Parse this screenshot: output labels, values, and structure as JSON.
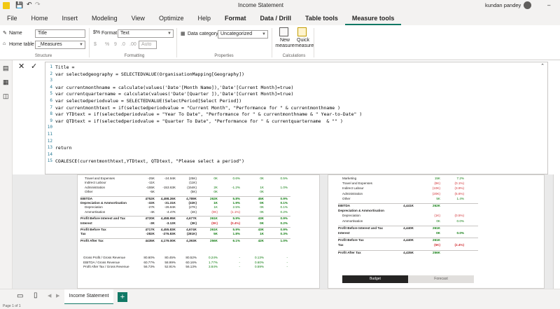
{
  "window": {
    "title": "Income Statement",
    "user": "kundan pandey"
  },
  "tabs": [
    {
      "label": "File"
    },
    {
      "label": "Home"
    },
    {
      "label": "Insert"
    },
    {
      "label": "Modeling"
    },
    {
      "label": "View"
    },
    {
      "label": "Optimize"
    },
    {
      "label": "Help"
    },
    {
      "label": "Format"
    },
    {
      "label": "Data / Drill"
    },
    {
      "label": "Table tools"
    },
    {
      "label": "Measure tools"
    }
  ],
  "ribbon": {
    "structure": {
      "name_label": "Name",
      "name_value": "Title",
      "hometable_label": "Home table",
      "hometable_value": "_Measures",
      "group": "Structure"
    },
    "formatting": {
      "format_label": "Format",
      "format_value": "Text",
      "auto_value": "Auto",
      "currency": "$",
      "percent": "%",
      "comma": "9",
      "group": "Formatting"
    },
    "properties": {
      "category_label": "Data category",
      "category_value": "Uncategorized",
      "group": "Properties"
    },
    "calculations": {
      "new_measure": "New measure",
      "quick_measure": "Quick measure",
      "group": "Calculations"
    }
  },
  "code_lines": [
    {
      "n": "1",
      "t": "Title ="
    },
    {
      "n": "2",
      "t": "var selectedgeography = SELECTEDVALUE(OrganisationMapping[Geography])"
    },
    {
      "n": "3",
      "t": ""
    },
    {
      "n": "4",
      "t": "var currentmonthname = calculate(values('Date'[Month Name]),'Date'[Current Month]=true)"
    },
    {
      "n": "5",
      "t": "var currentquartername = calculate(values('Date'[Quarter ]),'Date'[Current Month]=true)"
    },
    {
      "n": "6",
      "t": "var selectedperiodvalue = SELECTEDVALUE(SelectPeriod[Select Period])"
    },
    {
      "n": "7",
      "t": "var currentmonthtext = if(selectedperiodvalue = \"Current Month\", \"Performance for \" & currentmonthname )"
    },
    {
      "n": "8",
      "t": "var YTDtext = if(selectedperiodvalue = \"Year To Date\", \"Performance for \" & currentmonthname & \" Year-to-Date\" )"
    },
    {
      "n": "9",
      "t": "var QTDtext = if(selectedperiodvalue = \"Quarter To Date\", \"Performance for \" & currentquartername  & \"\" )"
    },
    {
      "n": "10",
      "t": ""
    },
    {
      "n": "11",
      "t": ""
    },
    {
      "n": "12",
      "t": ""
    },
    {
      "n": "13",
      "t": "return"
    },
    {
      "n": "14",
      "t": ""
    },
    {
      "n": "15",
      "t": "COALESCE(currentmonthtext,YTDtext, QTDtext, \"Please select a period\")"
    }
  ],
  "left_report": {
    "rows": [
      {
        "label": "Travel and Expenses",
        "a": "-25K",
        "b": "-24.94K",
        "c": "(25K)",
        "d": "0K",
        "e": "0.6%",
        "f": "0K",
        "g": "0.5%",
        "bold": false
      },
      {
        "label": "Indirect Labour",
        "a": "-11K",
        "b": "",
        "c": "(11K)",
        "d": "",
        "e": "",
        "f": "",
        "g": "",
        "bold": false
      },
      {
        "label": "Administration",
        "a": "-155K",
        "b": "-153.63K",
        "c": "(154K)",
        "d": "2K",
        "e": "-1.2%",
        "f": "1K",
        "g": "1.0%",
        "bold": false
      },
      {
        "label": "Other",
        "a": "-5K",
        "b": "",
        "c": "(5K)",
        "d": "0K",
        "e": "",
        "f": "0K",
        "g": "",
        "bold": false
      },
      {
        "label": "EBITDA",
        "a": "4752K",
        "b": "4,498.26K",
        "c": "4,789K",
        "d": "262K",
        "e": "5.8%",
        "f": "45K",
        "g": "0.9%",
        "bold": true
      },
      {
        "label": "Depreciation & Ammortisation",
        "a": "-32K",
        "b": "-31.31K",
        "c": "(32K)",
        "d": "1K",
        "e": "1.9%",
        "f": "0K",
        "g": "0.1%",
        "bold": true
      },
      {
        "label": "Depreciation",
        "a": "-27K",
        "b": "-26.84K",
        "c": "(27K)",
        "d": "1K",
        "e": "2.5%",
        "f": "0K",
        "g": "0.1%",
        "bold": false
      },
      {
        "label": "Ammortisation",
        "a": "-4K",
        "b": "-4.47K",
        "c": "(4K)",
        "d": "(0K)",
        "e": "(1.1%)",
        "f": "0K",
        "g": "0.2%",
        "bold": false
      },
      {
        "label": "Profit Before Interest and Tax",
        "a": "4720K",
        "b": "4,458.95K",
        "c": "4,677K",
        "d": "261K",
        "e": "5.9%",
        "f": "43K",
        "g": "0.9%",
        "bold": true
      },
      {
        "label": "Interest",
        "a": "-3K",
        "b": "-3.12K",
        "c": "(3K)",
        "d": "(0K)",
        "e": "(0.4%)",
        "f": "0K",
        "g": "0.2%",
        "bold": true
      },
      {
        "label": "Profit Before Tax",
        "a": "4717K",
        "b": "4,455.83K",
        "c": "4,674K",
        "d": "261K",
        "e": "5.9%",
        "f": "43K",
        "g": "0.9%",
        "bold": true
      },
      {
        "label": "Tax",
        "a": "-282K",
        "b": "-276.83K",
        "c": "(281K)",
        "d": "5K",
        "e": "1.8%",
        "f": "1K",
        "g": "0.3%",
        "bold": true
      },
      {
        "label": "Profit After Tax",
        "a": "4435K",
        "b": "4,179.00K",
        "c": "4,393K",
        "d": "256K",
        "e": "6.1%",
        "f": "42K",
        "g": "1.0%",
        "bold": true
      },
      {
        "label": "Gross Profit / Gross Revenue",
        "a": "80.60%",
        "b": "80.45%",
        "c": "80.52%",
        "d": "0.24%",
        "e": "-",
        "f": "0.13%",
        "g": "-",
        "bold": false
      },
      {
        "label": "EBITDA / Gross Revenue",
        "a": "60.77%",
        "b": "58.99%",
        "c": "60.16%",
        "d": "1.77%",
        "e": "-",
        "f": "0.60%",
        "g": "-",
        "bold": false
      },
      {
        "label": "Profit After Tax / Gross Revenue",
        "a": "56.73%",
        "b": "52.91%",
        "c": "56.13%",
        "d": "3.84%",
        "e": "-",
        "f": "0.59%",
        "g": "-",
        "bold": false
      }
    ]
  },
  "right_report": {
    "rows": [
      {
        "label": "Marketing",
        "a": "",
        "b": "15K",
        "c": "7.2%",
        "bold": false
      },
      {
        "label": "Travel and Expenses",
        "a": "",
        "b": "(8K)",
        "c": "(0.1%)",
        "bold": false
      },
      {
        "label": "Indirect Labour",
        "a": "",
        "b": "(10K)",
        "c": "(3.9%)",
        "bold": false
      },
      {
        "label": "Administration",
        "a": "",
        "b": "(20K)",
        "c": "(5.6%)",
        "bold": false
      },
      {
        "label": "Other",
        "a": "",
        "b": "5K",
        "c": "1.4%",
        "bold": false
      },
      {
        "label": "EBITDA",
        "a": "4,441K",
        "b": "262K",
        "c": "",
        "bold": true
      },
      {
        "label": "Depreciation & Ammortisation",
        "a": "",
        "b": "",
        "c": "",
        "bold": true
      },
      {
        "label": "Depreciation",
        "a": "",
        "b": "(1K)",
        "c": "(0.5%)",
        "bold": false
      },
      {
        "label": "Ammortisation",
        "a": "",
        "b": "0K",
        "c": "0.0%",
        "bold": false
      },
      {
        "label": "Profit Before Interest and Tax",
        "a": "4,440K",
        "b": "261K",
        "c": "",
        "bold": true
      },
      {
        "label": "Interest",
        "a": "",
        "b": "0K",
        "c": "0.0%",
        "bold": true
      },
      {
        "label": "Profit Before Tax",
        "a": "4,440K",
        "b": "261K",
        "c": "",
        "bold": true
      },
      {
        "label": "Tax",
        "a": "",
        "b": "(5K)",
        "c": "(2.4%)",
        "bold": true
      },
      {
        "label": "Profit After Tax",
        "a": "4,435K",
        "b": "256K",
        "c": "",
        "bold": true
      }
    ],
    "budget": "Budget",
    "forecast": "Forecast"
  },
  "bottom": {
    "page_tab": "Income Statement",
    "status": "Page 1 of 1"
  }
}
